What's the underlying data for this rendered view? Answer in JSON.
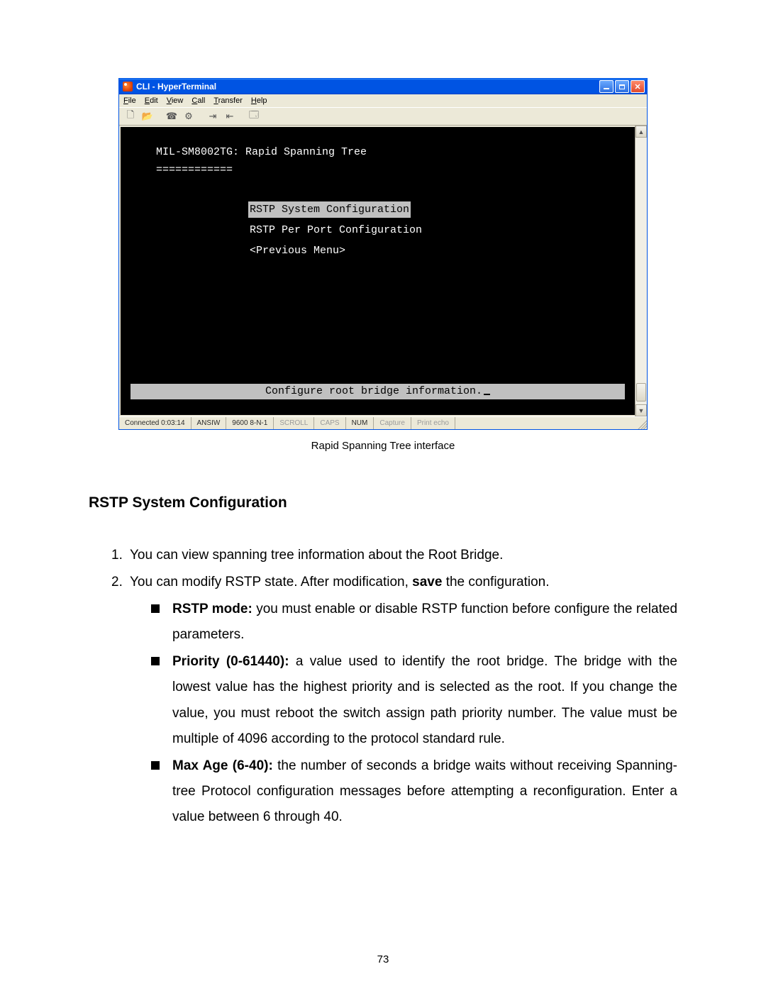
{
  "hyperterminal": {
    "title": "CLI - HyperTerminal",
    "menus": {
      "file": "File",
      "edit": "Edit",
      "view": "View",
      "call": "Call",
      "transfer": "Transfer",
      "help": "Help"
    },
    "terminal": {
      "header": "MIL-SM8002TG: Rapid Spanning Tree",
      "underline": "============",
      "menu_items": {
        "system_config": "RSTP System Configuration",
        "per_port_config": "RSTP Per Port Configuration",
        "previous_menu": "<Previous Menu>"
      },
      "status_line": "Configure root bridge information."
    },
    "statusbar": {
      "connected": "Connected 0:03:14",
      "emulation": "ANSIW",
      "port_settings": "9600 8-N-1",
      "scroll": "SCROLL",
      "caps": "CAPS",
      "num": "NUM",
      "capture": "Capture",
      "print_echo": "Print echo"
    }
  },
  "caption": "Rapid Spanning Tree interface",
  "section_heading": "RSTP System Configuration",
  "list": {
    "item1": "You can view spanning tree information about the Root Bridge.",
    "item2_prefix": "You can modify RSTP state. After modification, ",
    "item2_bold": "save",
    "item2_suffix": " the configuration.",
    "bullets": {
      "b1_bold": "RSTP mode:",
      "b1_text": " you must enable or disable RSTP function before configure the related parameters.",
      "b2_bold": "Priority (0-61440):",
      "b2_text": " a value used to identify the root bridge. The bridge with the lowest value has the highest priority and is selected as the root. If you change the value, you must reboot the switch assign path priority number. The value must be multiple of 4096 according to the protocol standard rule.",
      "b3_bold": "Max Age (6-40):",
      "b3_text": " the number of seconds a bridge waits without receiving Spanning-tree Protocol configuration messages before attempting a reconfiguration. Enter a value between 6 through 40."
    }
  },
  "page_number": "73"
}
